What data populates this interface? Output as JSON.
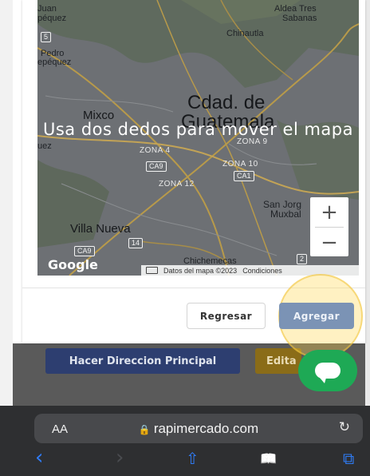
{
  "map": {
    "overlay_hint": "Usa dos dedos para mover el mapa",
    "cities": {
      "mixco": "Mixco",
      "main": "Cdad. de Guatemala",
      "main_line1": "Cdad. de",
      "main_line2": "Guatemala",
      "villa_nueva": "Villa Nueva",
      "chinautla": "Chinautla",
      "aldea": "Aldea Tres Sabanas",
      "aldea_line1": "Aldea Tres",
      "aldea_line2": "Sabanas",
      "juan": "Juan",
      "juan_sub": "péquez",
      "pedro": "Pedro",
      "pedro_sub": "epéquez",
      "san_jorge": "San Jorg",
      "muxbal": "Muxbal",
      "chichemecas": "Chichemecas",
      "uez": "uez"
    },
    "zones": [
      "ZONA 4",
      "ZONA 9",
      "ZONA 10",
      "ZONA 12"
    ],
    "roads": [
      "5",
      "CA9",
      "CA1",
      "14",
      "CA9",
      "2"
    ],
    "zoom_in": "+",
    "zoom_out": "−",
    "google_label": "Google",
    "attribution": "Datos del mapa ©2023",
    "terms": "Condiciones"
  },
  "modal": {
    "back_label": "Regresar",
    "add_label": "Agregar"
  },
  "page": {
    "make_primary_label": "Hacer Direccion Principal",
    "edit_label": "Edita"
  },
  "safari": {
    "text_size": "AA",
    "url": "rapimercado.com",
    "reload_icon": "↻",
    "back_icon": "‹",
    "forward_icon": "›",
    "share_icon": "⇧",
    "bookmarks_icon": "📖",
    "tabs_icon": "⧉"
  },
  "colors": {
    "add_button": "#7b93b5",
    "primary_button": "#2d3e70",
    "edit_button": "#8a6c18",
    "chat": "#1ea955",
    "link_blue": "#2f7cf6"
  }
}
